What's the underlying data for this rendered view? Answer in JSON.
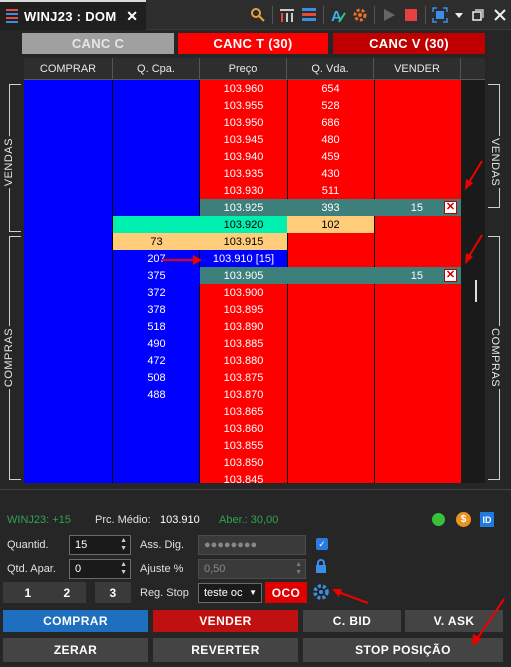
{
  "tab": {
    "title": "WINJ23 : DOM",
    "close": "✕"
  },
  "toolbar": {
    "icons": [
      "magnify-tool-icon",
      "bar-chart-icon",
      "heatmap-grid-icon",
      "font-a-icon",
      "settings-icon",
      "play-icon",
      "stop-icon",
      "fit-screen-icon",
      "dropdown-icon",
      "restore-icon",
      "close-window-icon"
    ]
  },
  "cancel": {
    "c": "CANC C",
    "t": "CANC T (30)",
    "v": "CANC V (30)"
  },
  "side": {
    "vendas": "VENDAS",
    "compras": "COMPRAS"
  },
  "headers": [
    "COMPRAR",
    "Q. Cpa.",
    "Preço",
    "Q. Vda.",
    "VENDER"
  ],
  "rows": [
    {
      "price": "103.960",
      "qv": "654"
    },
    {
      "price": "103.955",
      "qv": "528"
    },
    {
      "price": "103.950",
      "qv": "686"
    },
    {
      "price": "103.945",
      "qv": "480"
    },
    {
      "price": "103.940",
      "qv": "459"
    },
    {
      "price": "103.935",
      "qv": "430"
    },
    {
      "price": "103.930",
      "qv": "511"
    },
    {
      "price": "103.925",
      "qv": "393",
      "vender": "15",
      "x": true,
      "hl": "teal"
    },
    {
      "price": "103.920",
      "qv": "102",
      "hl": "best-ask"
    },
    {
      "price": "103.915",
      "qc": "73",
      "hl": "best-bid"
    },
    {
      "price": "103.910 [15]",
      "qc": "207",
      "hl": "last"
    },
    {
      "price": "103.905",
      "qc": "375",
      "vender": "15",
      "x": true,
      "hl": "teal"
    },
    {
      "price": "103.900",
      "qc": "372"
    },
    {
      "price": "103.895",
      "qc": "378"
    },
    {
      "price": "103.890",
      "qc": "518"
    },
    {
      "price": "103.885",
      "qc": "490"
    },
    {
      "price": "103.880",
      "qc": "472"
    },
    {
      "price": "103.875",
      "qc": "508"
    },
    {
      "price": "103.870",
      "qc": "488"
    },
    {
      "price": "103.865"
    },
    {
      "price": "103.860"
    },
    {
      "price": "103.855"
    },
    {
      "price": "103.850"
    },
    {
      "price": "103.845"
    }
  ],
  "status": {
    "asset": "WINJ23: +15",
    "pm_label": "Prc. Médio:",
    "pm_value": "103.910",
    "aber": "Aber.: 30,00",
    "dollar": "$",
    "id": "ID"
  },
  "form": {
    "quantid_label": "Quantid.",
    "quantid": "15",
    "ass_label": "Ass. Dig.",
    "ass_value": "●●●●●●●●",
    "qtd_apar_label": "Qtd. Apar.",
    "qtd_apar": "0",
    "ajuste_label": "Ajuste %",
    "ajuste": "0,50",
    "q1": "1",
    "q2": "2",
    "q3": "3",
    "regstop_label": "Reg. Stop",
    "regstop_value": "teste oc",
    "oco": "OCO"
  },
  "buttons": {
    "comprar": "COMPRAR",
    "vender": "VENDER",
    "cbid": "C. BID",
    "vask": "V. ASK",
    "zerar": "ZERAR",
    "reverter": "REVERTER",
    "stop": "STOP POSIÇÃO"
  },
  "colors": {
    "buy": "#0000ff",
    "sell": "#ff0000",
    "teal": "#3d7f7a",
    "best_ask": "#00f0b0",
    "best_bid": "#ffcc7a"
  }
}
